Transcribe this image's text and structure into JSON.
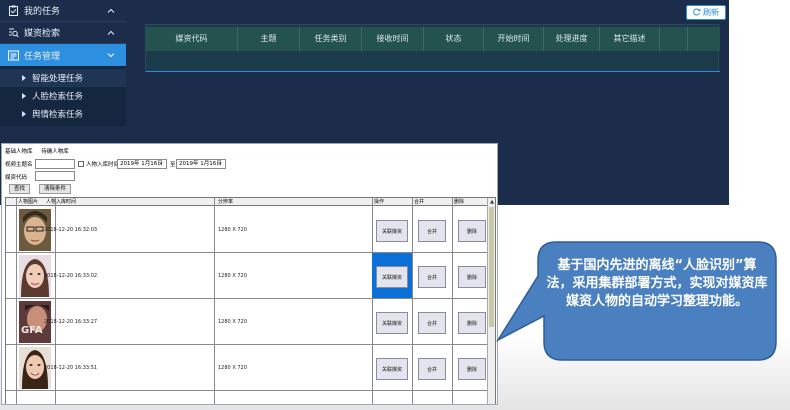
{
  "sidebar": {
    "items": [
      {
        "label": "我的任务",
        "icon": "clipboard-icon"
      },
      {
        "label": "媒资检索",
        "icon": "search-list-icon"
      },
      {
        "label": "任务管理",
        "icon": "task-list-icon"
      }
    ],
    "sub_items": [
      {
        "label": "智能处理任务"
      },
      {
        "label": "人脸检索任务"
      },
      {
        "label": "舆情检索任务"
      }
    ]
  },
  "toolbar": {
    "refresh_label": "刷新"
  },
  "task_table": {
    "columns": [
      "媒资代码",
      "主题",
      "任务类别",
      "接收时间",
      "状态",
      "开始时间",
      "处理进度",
      "其它描述"
    ]
  },
  "face_window": {
    "tabs": [
      "基础人物库",
      "待确人物库"
    ],
    "filter": {
      "video_title_label": "视频主题名",
      "video_title_value": "",
      "date_checkbox_label": "人物入库时间",
      "date_from": "2019年 1月16日",
      "to_label": "至",
      "date_to": "2019年 1月16日",
      "media_code_label": "媒资代码",
      "media_code_value": "",
      "search_label": "查找",
      "clear_label": "清除条件"
    },
    "columns": [
      "人物图片",
      "人物入库时间",
      "分辨率",
      "操作",
      "合并",
      "删除"
    ],
    "rows": [
      {
        "time": "2018-12-20 16:32:03",
        "resolution": "1280 X 720",
        "action": "关联媒资",
        "merge": "合并",
        "delete": "删除"
      },
      {
        "time": "2018-12-20 16:33:02",
        "resolution": "1280 X 720",
        "action": "关联媒资",
        "merge": "合并",
        "delete": "删除"
      },
      {
        "time": "2018-12-20 16:33:27",
        "resolution": "1280 X 720",
        "action": "关联媒资",
        "merge": "合并",
        "delete": "删除"
      },
      {
        "time": "2018-12-20 16:33:51",
        "resolution": "1280 X 720",
        "action": "关联媒资",
        "merge": "合并",
        "delete": "删除"
      }
    ],
    "photo_watermark": "GFA"
  },
  "callout": {
    "text": "基于国内先进的离线“人脸识别”算法，采用集群部署方式，实现对媒资库媒资人物的自动学习整理功能。"
  },
  "colors": {
    "app_bg": "#1b2d4a",
    "active_blue": "#2d8fe0",
    "header_teal": "#24524f",
    "callout_fill": "#4a7fc0"
  }
}
